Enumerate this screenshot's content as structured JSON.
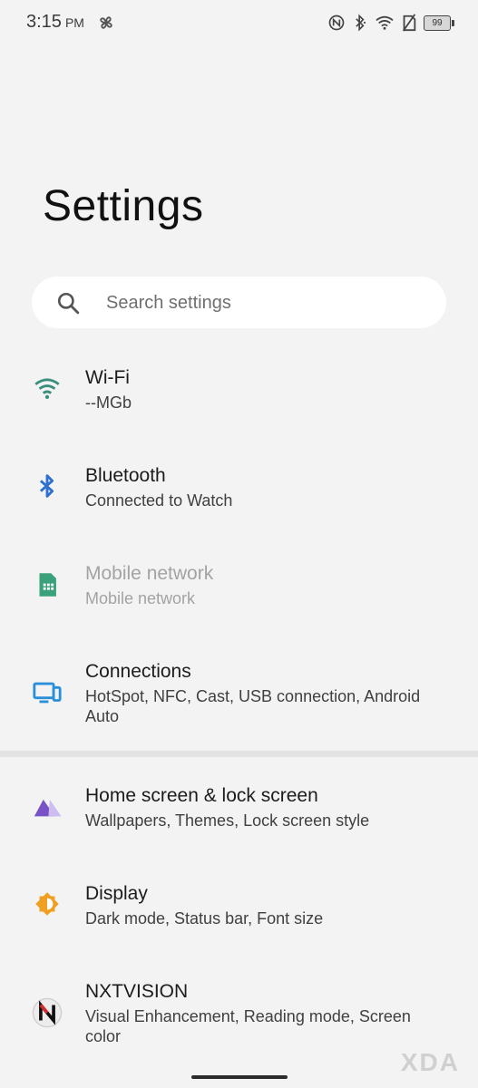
{
  "status_bar": {
    "time": "3:15",
    "ampm": "PM",
    "battery": "99",
    "icons": [
      "fan-icon",
      "nfc-icon",
      "bluetooth-icon",
      "wifi-icon",
      "no-sim-icon",
      "battery-icon"
    ]
  },
  "page": {
    "title": "Settings"
  },
  "search": {
    "placeholder": "Search settings"
  },
  "items": [
    {
      "title": "Wi-Fi",
      "subtitle": "--MGb",
      "icon": "wifi-icon",
      "color": "#3a8f7c",
      "enabled": true
    },
    {
      "title": "Bluetooth",
      "subtitle": "Connected to Watch",
      "icon": "bluetooth-icon",
      "color": "#2f6fd0",
      "enabled": true
    },
    {
      "title": "Mobile network",
      "subtitle": "Mobile network",
      "icon": "sim-card-icon",
      "color": "#3aa17a",
      "enabled": false
    },
    {
      "title": "Connections",
      "subtitle": "HotSpot, NFC, Cast, USB connection, Android Auto",
      "icon": "devices-icon",
      "color": "#2a8fd8",
      "enabled": true
    },
    {
      "title": "Home screen & lock screen",
      "subtitle": "Wallpapers, Themes, Lock screen style",
      "icon": "home-screen-icon",
      "color": "#7a52c8",
      "enabled": true
    },
    {
      "title": "Display",
      "subtitle": "Dark mode, Status bar, Font size",
      "icon": "display-icon",
      "color": "#f0a020",
      "enabled": true
    },
    {
      "title": "NXTVISION",
      "subtitle": "Visual Enhancement, Reading mode, Screen color",
      "icon": "nxtvision-icon",
      "color": "#d42a2a",
      "enabled": true
    }
  ],
  "watermark": "XDA"
}
